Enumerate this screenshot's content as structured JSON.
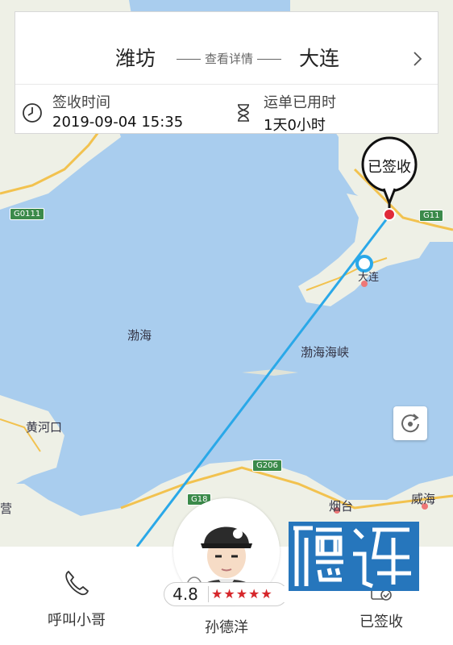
{
  "route": {
    "from_city": "潍坊",
    "to_city": "大连",
    "detail_link": "查看详情"
  },
  "sign_info": {
    "time_label": "签收时间",
    "time_value": "2019-09-04 15:35",
    "duration_label": "运单已用时",
    "duration_value": "1天0小时"
  },
  "map": {
    "pin_label": "已签收",
    "labels": {
      "bohai": "渤海",
      "strait": "渤海海峡",
      "yellow_river": "黄河口",
      "yantai": "烟台",
      "weihai": "威海",
      "dalian": "大连",
      "ying": "营"
    },
    "roads": {
      "g0111": "G0111",
      "g11": "G11",
      "g206": "G206",
      "g18": "G18"
    }
  },
  "bottom_bar": {
    "call_label": "呼叫小哥",
    "signed_label": "已签收"
  },
  "courier": {
    "name": "孙德洋",
    "rating": "4.8",
    "stars": "★★★★★"
  },
  "colors": {
    "sea": "#a9cdee",
    "land": "#eef0e6",
    "route_line": "#2aa8e8",
    "pin_red": "#e02a3a",
    "star_red": "#d6262a",
    "road_green": "#3b8a4a",
    "watermark_blue": "#1a6fb8"
  }
}
